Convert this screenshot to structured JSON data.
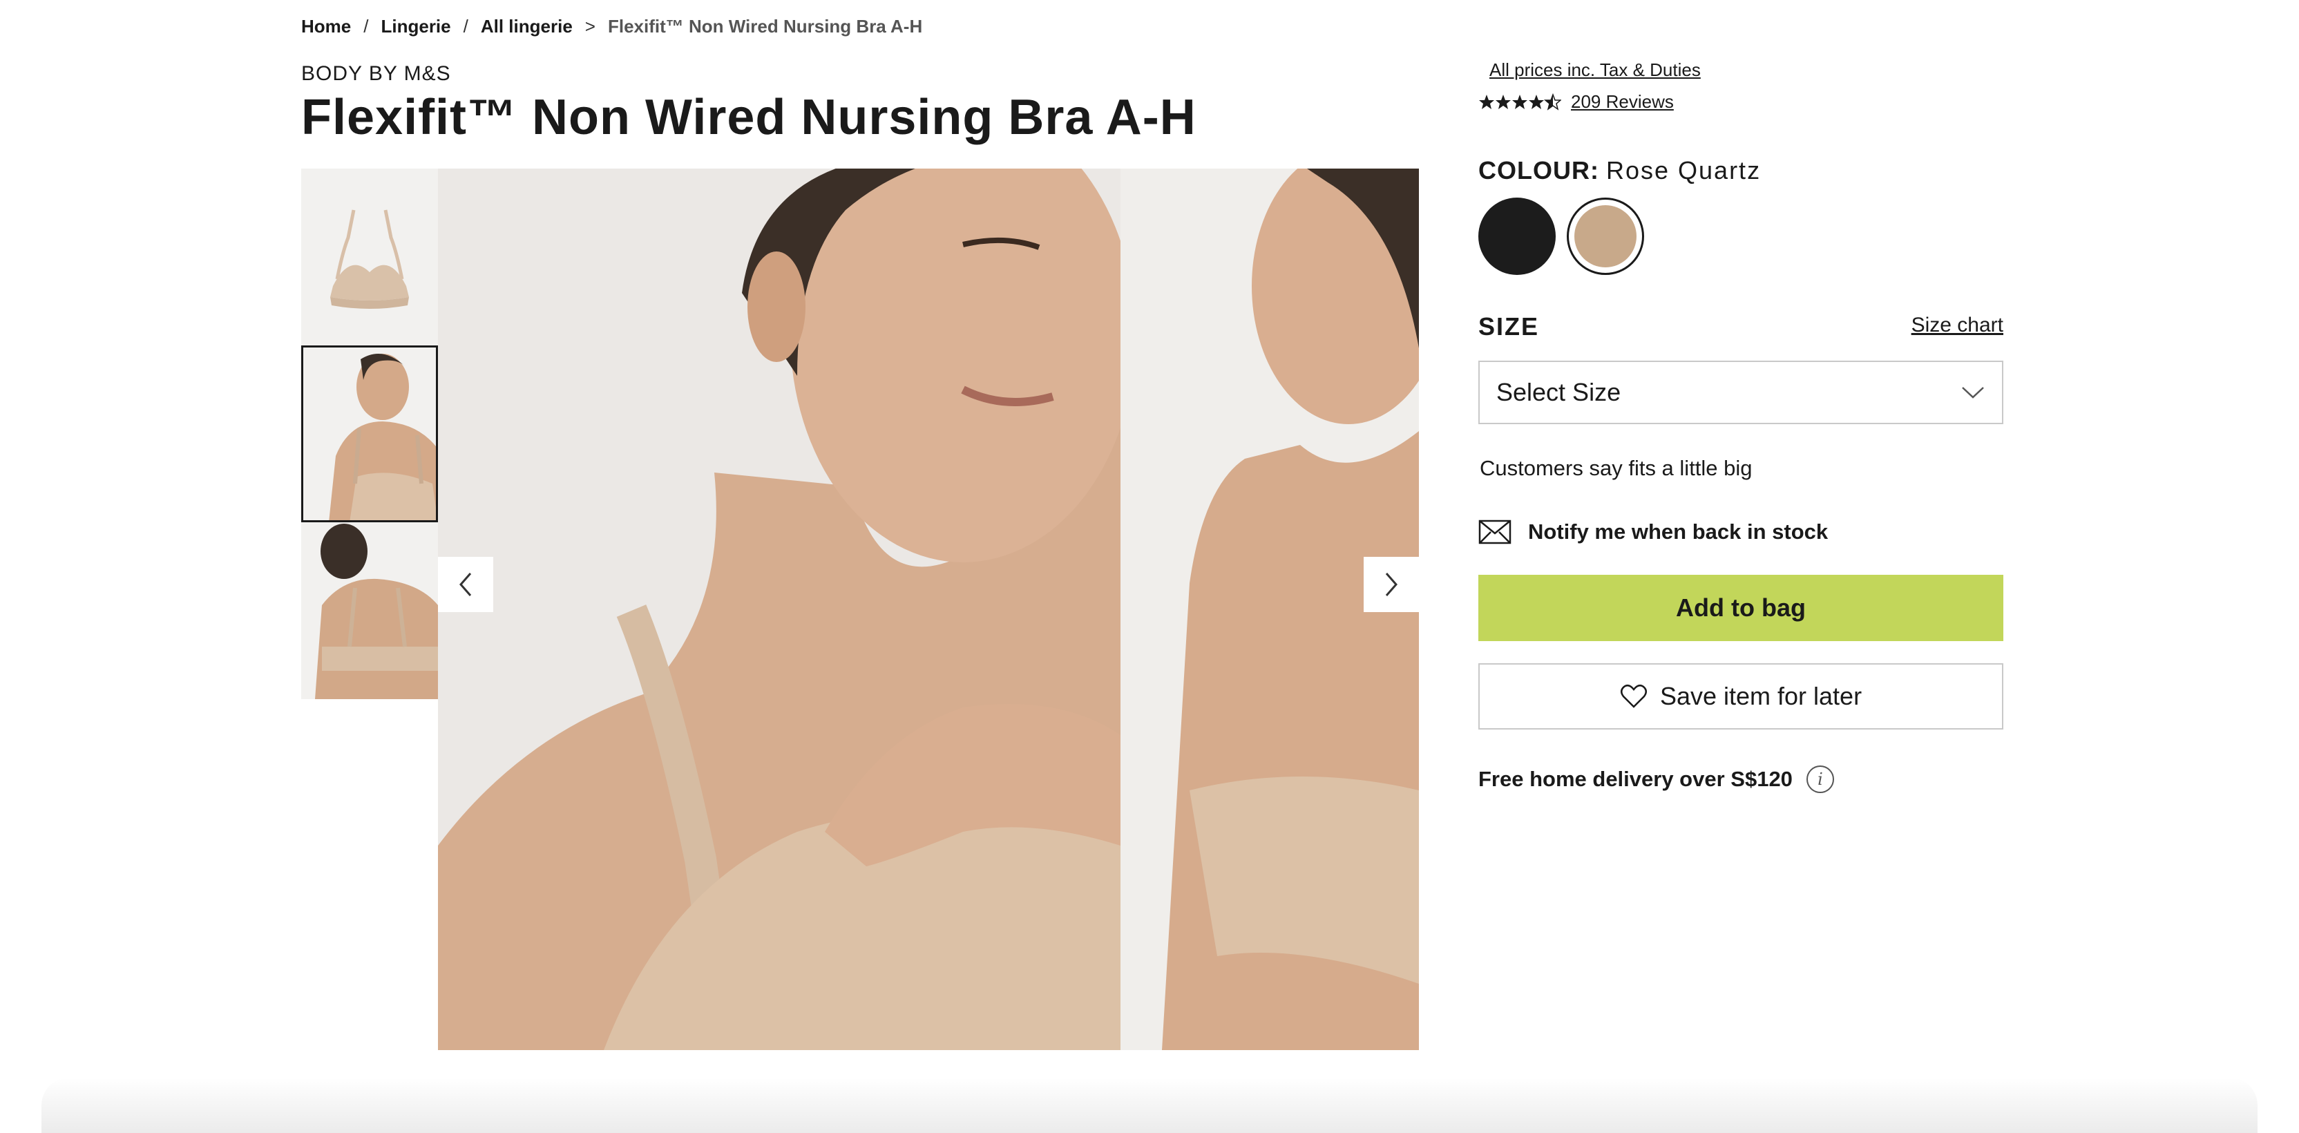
{
  "breadcrumb": {
    "items": [
      "Home",
      "Lingerie",
      "All lingerie"
    ],
    "sep1": "/",
    "sep2": "/",
    "sep3": ">",
    "current": "Flexifit™ Non Wired Nursing Bra A-H"
  },
  "product": {
    "brand": "BODY BY M&S",
    "title": "Flexifit™ Non Wired Nursing Bra A-H",
    "prices_note": "All prices inc. Tax & Duties",
    "rating_value": 4.5,
    "reviews_label": "209 Reviews"
  },
  "colour": {
    "label": "COLOUR:",
    "selected": "Rose  Quartz",
    "swatches": [
      {
        "name": "Black",
        "hex": "#1c1c1c"
      },
      {
        "name": "Rose Quartz",
        "hex": "#c8a98a"
      }
    ]
  },
  "size": {
    "label": "SIZE",
    "chart_link": "Size chart",
    "select_placeholder": "Select Size",
    "fit_note": "Customers say fits a little big"
  },
  "actions": {
    "notify": "Notify me when back in stock",
    "add_to_bag": "Add to bag",
    "save_later": "Save item for later"
  },
  "delivery": {
    "text": "Free home delivery over S$120"
  },
  "gallery": {
    "active_thumb": 2,
    "thumb_count": 3
  },
  "colors": {
    "add_to_bag_bg": "#c2d65a",
    "skin_tone": "#c8a98a"
  }
}
